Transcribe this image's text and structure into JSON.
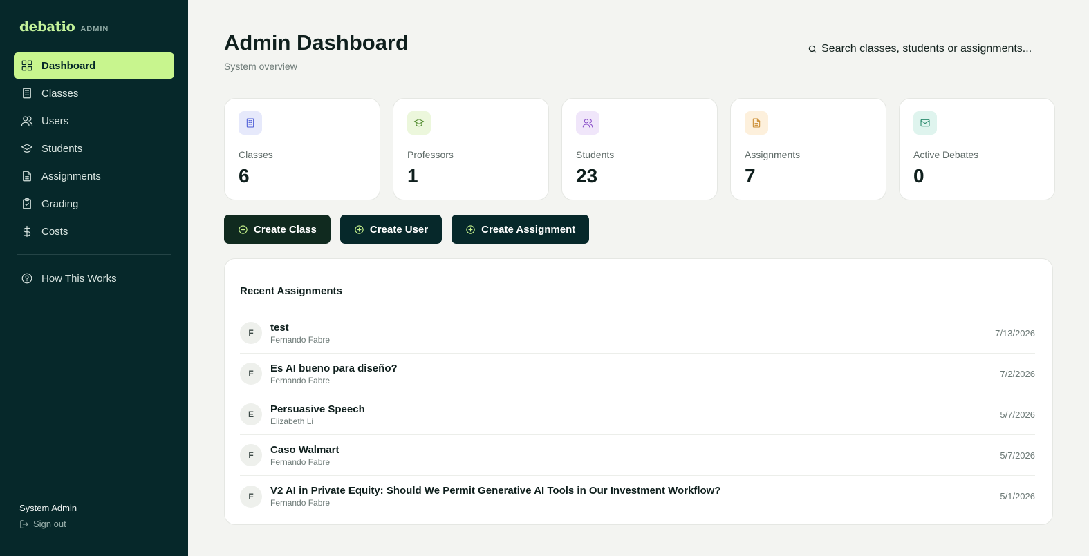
{
  "brand": {
    "logo": "debatio",
    "tag": "ADMIN"
  },
  "sidebar": {
    "items": [
      {
        "label": "Dashboard",
        "icon": "grid-icon",
        "active": true
      },
      {
        "label": "Classes",
        "icon": "building-icon"
      },
      {
        "label": "Users",
        "icon": "users-icon"
      },
      {
        "label": "Students",
        "icon": "graduation-cap-icon"
      },
      {
        "label": "Assignments",
        "icon": "file-icon"
      },
      {
        "label": "Grading",
        "icon": "clipboard-check-icon"
      },
      {
        "label": "Costs",
        "icon": "dollar-icon"
      }
    ],
    "help": {
      "label": "How This Works",
      "icon": "help-circle-icon"
    },
    "user": {
      "name": "System Admin",
      "signout": "Sign out"
    }
  },
  "header": {
    "title": "Admin Dashboard",
    "subtitle": "System overview",
    "search_text": "Search classes, students or assignments..."
  },
  "stats": [
    {
      "label": "Classes",
      "value": "6",
      "icon": "building-icon",
      "bg": "#e6e9fb",
      "color": "#4b5bd6"
    },
    {
      "label": "Professors",
      "value": "1",
      "icon": "graduation-cap-icon",
      "bg": "#ecf7dc",
      "color": "#4f8a2b"
    },
    {
      "label": "Students",
      "value": "23",
      "icon": "users-icon",
      "bg": "#f0e6fa",
      "color": "#8a4fc9"
    },
    {
      "label": "Assignments",
      "value": "7",
      "icon": "file-icon",
      "bg": "#fdf0dc",
      "color": "#c98a2e"
    },
    {
      "label": "Active Debates",
      "value": "0",
      "icon": "mail-icon",
      "bg": "#dff4ee",
      "color": "#2a8a6d"
    }
  ],
  "actions": [
    {
      "label": "Create Class"
    },
    {
      "label": "Create User"
    },
    {
      "label": "Create Assignment"
    }
  ],
  "recent": {
    "title": "Recent Assignments",
    "items": [
      {
        "initial": "F",
        "title": "test",
        "author": "Fernando Fabre",
        "date": "7/13/2026"
      },
      {
        "initial": "F",
        "title": "Es AI bueno para diseño?",
        "author": "Fernando Fabre",
        "date": "7/2/2026"
      },
      {
        "initial": "E",
        "title": "Persuasive Speech",
        "author": "Elizabeth Li",
        "date": "5/7/2026"
      },
      {
        "initial": "F",
        "title": "Caso Walmart",
        "author": "Fernando Fabre",
        "date": "5/7/2026"
      },
      {
        "initial": "F",
        "title": "V2 AI in Private Equity: Should We Permit Generative AI Tools in Our Investment Workflow?",
        "author": "Fernando Fabre",
        "date": "5/1/2026"
      }
    ]
  }
}
